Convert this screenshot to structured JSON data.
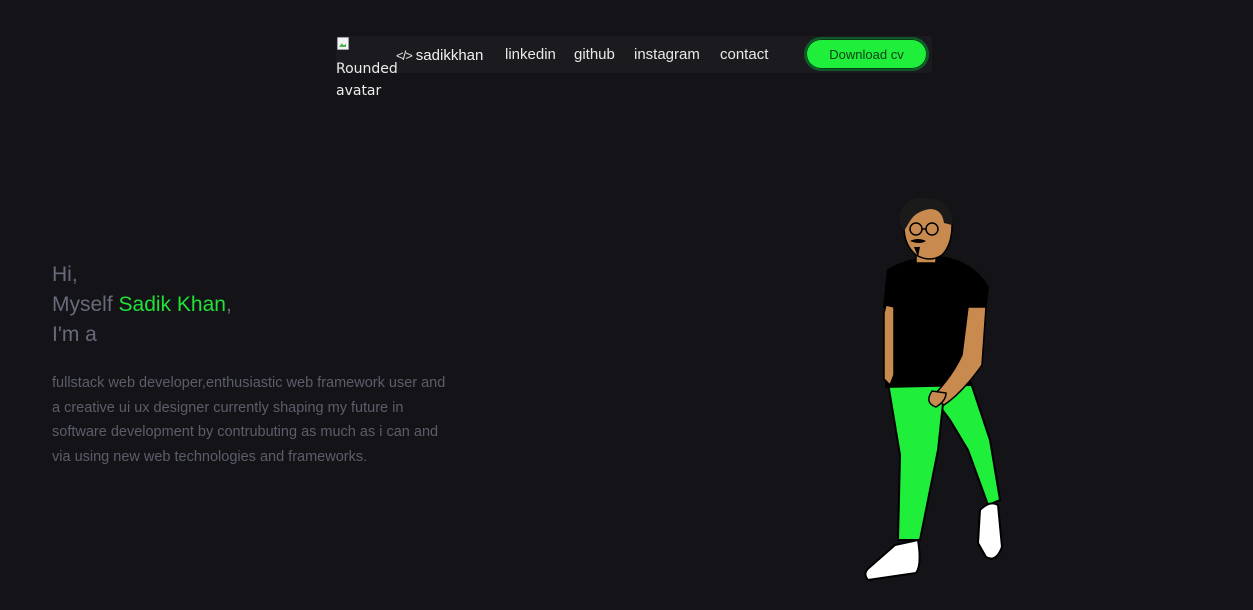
{
  "nav": {
    "avatar_alt_line1": "Rounded",
    "avatar_alt_line2": "avatar",
    "brand_icon": "</>",
    "brand_name": "sadikkhan",
    "links": [
      {
        "label": "linkedin"
      },
      {
        "label": "github"
      },
      {
        "label": "instagram"
      },
      {
        "label": "contact"
      }
    ],
    "download_label": "Download cv"
  },
  "hero": {
    "greeting": "Hi,",
    "myself_prefix": "Myself ",
    "name": "Sadik Khan",
    "myself_suffix": ",",
    "im_a": "I'm a",
    "description": "fullstack web developer,enthusiastic web framework user and a creative ui ux designer currently shaping my future in software development by contrubuting as much as i can and via using new web technologies and frameworks."
  },
  "colors": {
    "background": "#141317",
    "accent": "#22e037",
    "button": "#1fef3a",
    "muted_text": "#676a78"
  },
  "icons": {
    "brand": "code-icon",
    "avatar": "broken-image-icon"
  }
}
